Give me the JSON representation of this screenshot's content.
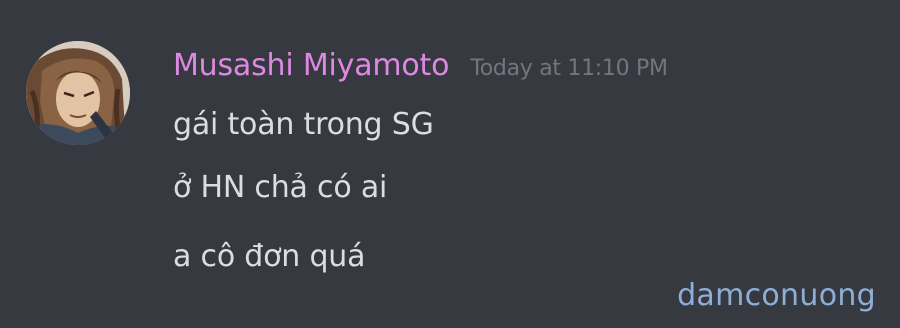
{
  "message": {
    "author": {
      "username": "Musashi Miyamoto",
      "name_color": "#dd88e3",
      "avatar_icon": "samurai-avatar-icon"
    },
    "timestamp": "Today at 11:10 PM",
    "lines": [
      "gái toàn trong SG",
      "ở HN chả có ai",
      "a cô đơn quá"
    ]
  },
  "watermark": "damconuong",
  "colors": {
    "background": "#36393f",
    "message_text": "#dcddde",
    "timestamp": "#72767d",
    "watermark": "#8eaed8"
  }
}
